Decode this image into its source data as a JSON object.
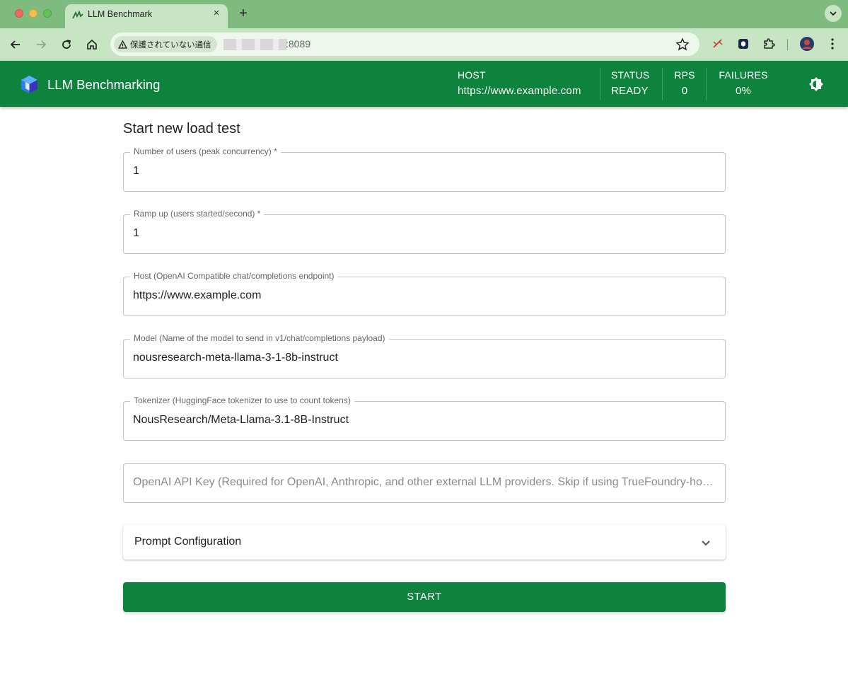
{
  "browser": {
    "tab_title": "LLM Benchmark",
    "tab_close": "×",
    "new_tab": "+",
    "security_label": "保護されていない通信",
    "url_port": ":8089"
  },
  "app": {
    "title": "LLM Benchmarking",
    "stats": {
      "host_label": "HOST",
      "host_value": "https://www.example.com",
      "status_label": "STATUS",
      "status_value": "READY",
      "rps_label": "RPS",
      "rps_value": "0",
      "failures_label": "FAILURES",
      "failures_value": "0%"
    },
    "colors": {
      "primary": "#0e833d",
      "browser_frame": "#7fba7f",
      "browser_toolbar": "#c7e5c3"
    }
  },
  "form": {
    "title": "Start new load test",
    "fields": [
      {
        "label": "Number of users (peak concurrency) *",
        "value": "1"
      },
      {
        "label": "Ramp up (users started/second) *",
        "value": "1"
      },
      {
        "label": "Host (OpenAI Compatible chat/completions endpoint)",
        "value": "https://www.example.com"
      },
      {
        "label": "Model (Name of the model to send in v1/chat/completions payload)",
        "value": "nousresearch-meta-llama-3-1-8b-instruct"
      },
      {
        "label": "Tokenizer (HuggingFace tokenizer to use to count tokens)",
        "value": "NousResearch/Meta-Llama-3.1-8B-Instruct"
      }
    ],
    "api_key_placeholder": "OpenAI API Key (Required for OpenAI, Anthropic, and other external LLM providers. Skip if using TrueFoundry-hosted models)",
    "accordion_label": "Prompt Configuration",
    "start_label": "START"
  }
}
